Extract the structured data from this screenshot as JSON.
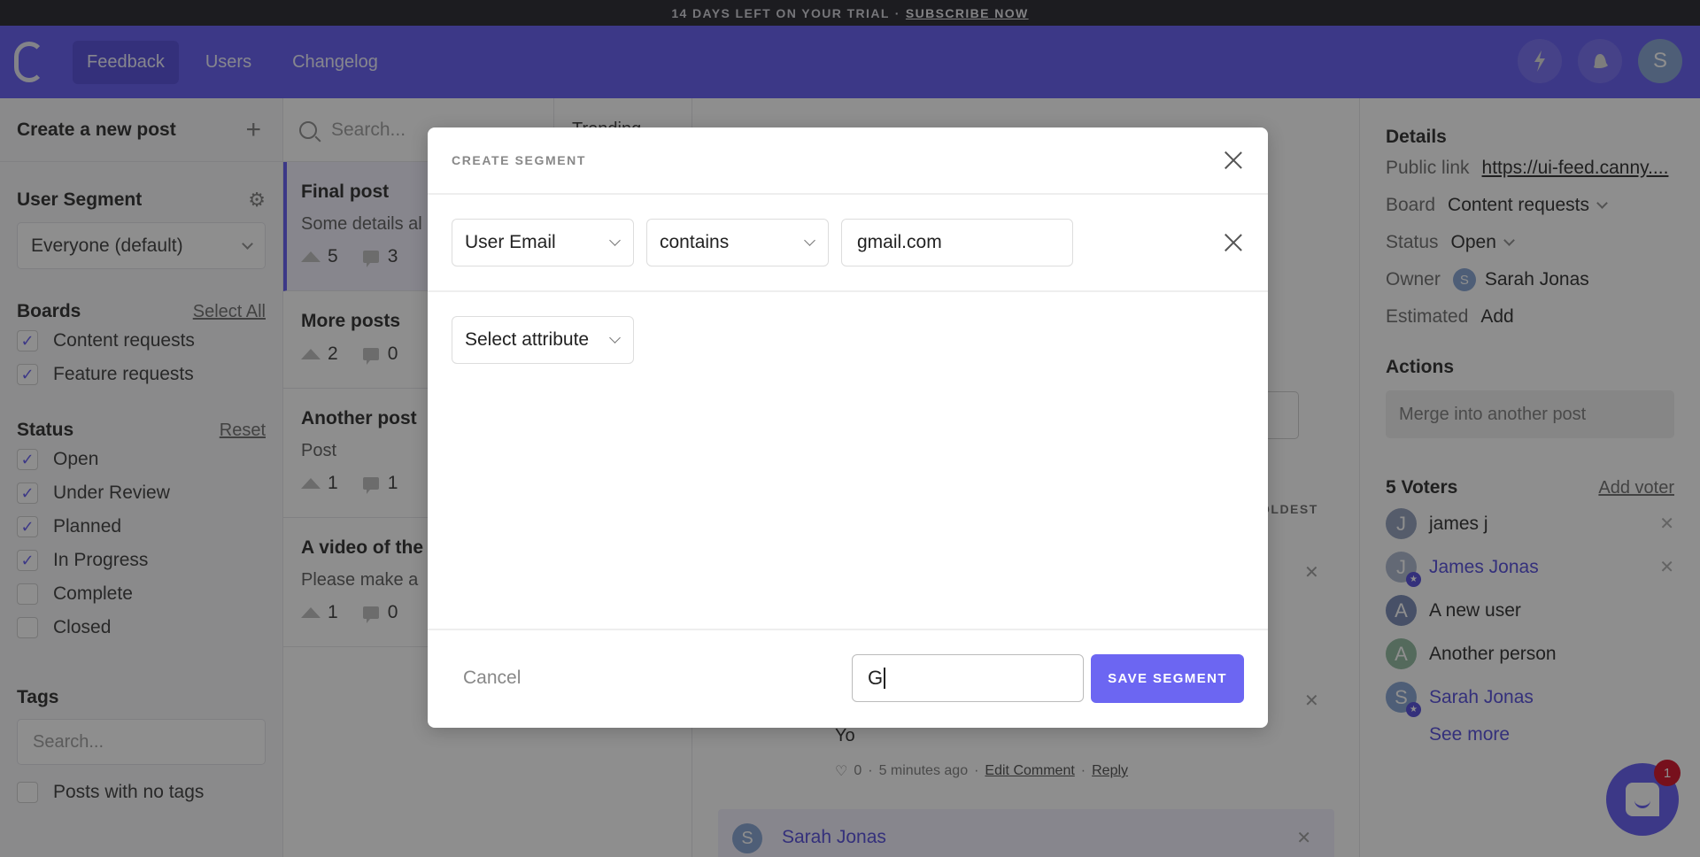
{
  "trial_bar": {
    "text": "14 DAYS LEFT ON YOUR TRIAL",
    "separator": "·",
    "subscribe": "SUBSCRIBE NOW"
  },
  "nav": {
    "items": [
      {
        "label": "Feedback",
        "active": true
      },
      {
        "label": "Users"
      },
      {
        "label": "Changelog"
      }
    ],
    "icons": [
      "lightning-icon",
      "bell-icon"
    ],
    "avatar_initial": "S"
  },
  "sidebar": {
    "create_post": "Create a new post",
    "user_segment": {
      "title": "User Segment",
      "value": "Everyone (default)"
    },
    "boards": {
      "title": "Boards",
      "action": "Select All",
      "items": [
        {
          "label": "Content requests",
          "checked": true
        },
        {
          "label": "Feature requests",
          "checked": true
        }
      ]
    },
    "status": {
      "title": "Status",
      "action": "Reset",
      "items": [
        {
          "label": "Open",
          "checked": true
        },
        {
          "label": "Under Review",
          "checked": true
        },
        {
          "label": "Planned",
          "checked": true
        },
        {
          "label": "In Progress",
          "checked": true
        },
        {
          "label": "Complete",
          "checked": false
        },
        {
          "label": "Closed",
          "checked": false
        }
      ]
    },
    "tags": {
      "title": "Tags",
      "search_placeholder": "Search...",
      "no_tags_label": "Posts with no tags"
    }
  },
  "postlist": {
    "search_placeholder": "Search...",
    "sort_label": "Trending",
    "posts": [
      {
        "title": "Final post",
        "desc": "Some details al",
        "votes": "5",
        "comments": "3"
      },
      {
        "title": "More posts",
        "desc": "",
        "votes": "2",
        "comments": "0"
      },
      {
        "title": "Another post",
        "desc": "Post",
        "votes": "1",
        "comments": "1"
      },
      {
        "title": "A video of the",
        "desc": "Please make a",
        "votes": "1",
        "comments": "0"
      }
    ]
  },
  "main": {
    "sort_label": "OLDEST",
    "comment": {
      "text": "Yo",
      "likes": "0",
      "time": "5 minutes ago",
      "edit": "Edit Comment",
      "reply": "Reply"
    },
    "next_comment_author": "Sarah Jonas",
    "next_comment_initial": "S"
  },
  "details": {
    "title": "Details",
    "rows": {
      "public_link_label": "Public link",
      "public_link": "https://ui-feed.canny....",
      "board_label": "Board",
      "board": "Content requests",
      "status_label": "Status",
      "status": "Open",
      "owner_label": "Owner",
      "owner": "Sarah Jonas",
      "owner_initial": "S",
      "estimated_label": "Estimated",
      "estimated": "Add"
    },
    "actions_title": "Actions",
    "merge": "Merge into another post",
    "voters_title": "5 Voters",
    "add_voter": "Add voter",
    "voters": [
      {
        "initial": "J",
        "name": "james j",
        "color": "#8c9bb8",
        "removable": true
      },
      {
        "initial": "J",
        "name": "James Jonas",
        "color": "#a9b4cc",
        "admin": true,
        "removable": true
      },
      {
        "initial": "A",
        "name": "A new user",
        "color": "#7083b0"
      },
      {
        "initial": "A",
        "name": "Another person",
        "color": "#8ab69a"
      },
      {
        "initial": "S",
        "name": "Sarah Jonas",
        "color": "#7f9fd0",
        "admin": true
      }
    ],
    "see_more": "See more"
  },
  "chat": {
    "badge": "1"
  },
  "modal": {
    "title": "CREATE SEGMENT",
    "filter": {
      "attribute": "User Email",
      "operator": "contains",
      "value": "gmail.com"
    },
    "new_filter_placeholder": "Select attribute",
    "cancel": "Cancel",
    "name_value": "G",
    "save": "SAVE SEGMENT"
  },
  "colors": {
    "accent": "#5a52f0",
    "save_button": "#6c66f2",
    "badge": "#d0021b"
  }
}
